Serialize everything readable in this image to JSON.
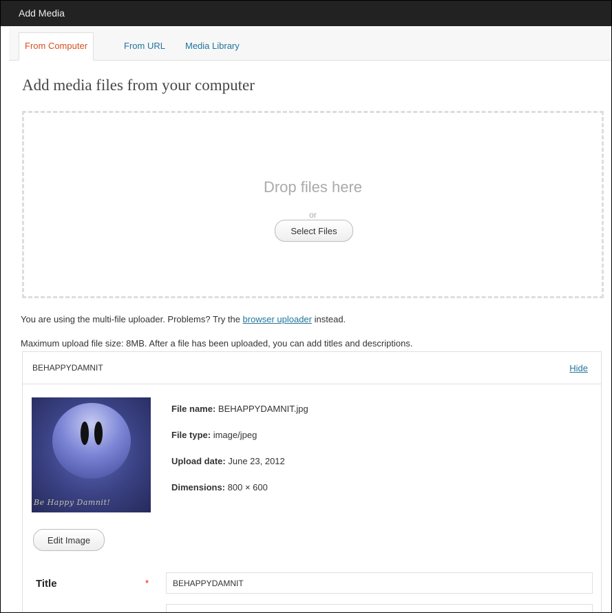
{
  "window": {
    "title": "Add Media"
  },
  "tabs": [
    {
      "label": "From Computer",
      "active": true
    },
    {
      "label": "From URL",
      "active": false
    },
    {
      "label": "Media Library",
      "active": false
    }
  ],
  "heading": "Add media files from your computer",
  "dropzone": {
    "drop_text": "Drop files here",
    "or_text": "or",
    "select_button": "Select Files"
  },
  "uploader_notice": {
    "prefix": "You are using the multi-file uploader. Problems? Try the",
    "link": "browser uploader",
    "suffix": "instead."
  },
  "max_upload_text": "Maximum upload file size: 8MB. After a file has been uploaded, you can add titles and descriptions.",
  "media_item": {
    "name": "BEHAPPYDAMNIT",
    "hide_label": "Hide",
    "thumbnail_caption": "Be Happy Damnit!",
    "file_name_label": "File name:",
    "file_name": "BEHAPPYDAMNIT.jpg",
    "file_type_label": "File type:",
    "file_type": "image/jpeg",
    "upload_date_label": "Upload date:",
    "upload_date": "June 23, 2012",
    "dimensions_label": "Dimensions:",
    "dimensions": "800 × 600",
    "edit_button": "Edit Image",
    "title_label": "Title",
    "required_marker": "*",
    "title_value": "BEHAPPYDAMNIT"
  },
  "colors": {
    "titlebar": "#222222",
    "link": "#21759b",
    "active_tab": "#d54e21",
    "required": "#ff0000"
  }
}
